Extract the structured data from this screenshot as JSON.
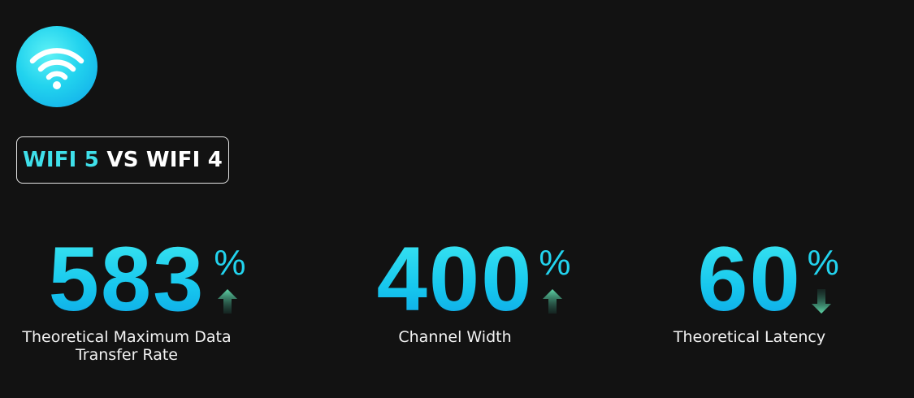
{
  "badge": {
    "icon": "wifi-icon",
    "color": "#22d3ee"
  },
  "comparison": {
    "accent_text": "WIFI 5",
    "rest_text": "VS WIFI 4",
    "accent_color": "#3fe0ea"
  },
  "stats": [
    {
      "value": "583",
      "unit": "%",
      "direction": "up",
      "label": "Theoretical Maximum Data\nTransfer Rate"
    },
    {
      "value": "400",
      "unit": "%",
      "direction": "up",
      "label": "Channel Width"
    },
    {
      "value": "60",
      "unit": "%",
      "direction": "down",
      "label": "Theoretical Latency"
    }
  ],
  "colors": {
    "background": "#121212",
    "arrow": "#3aa58a"
  }
}
